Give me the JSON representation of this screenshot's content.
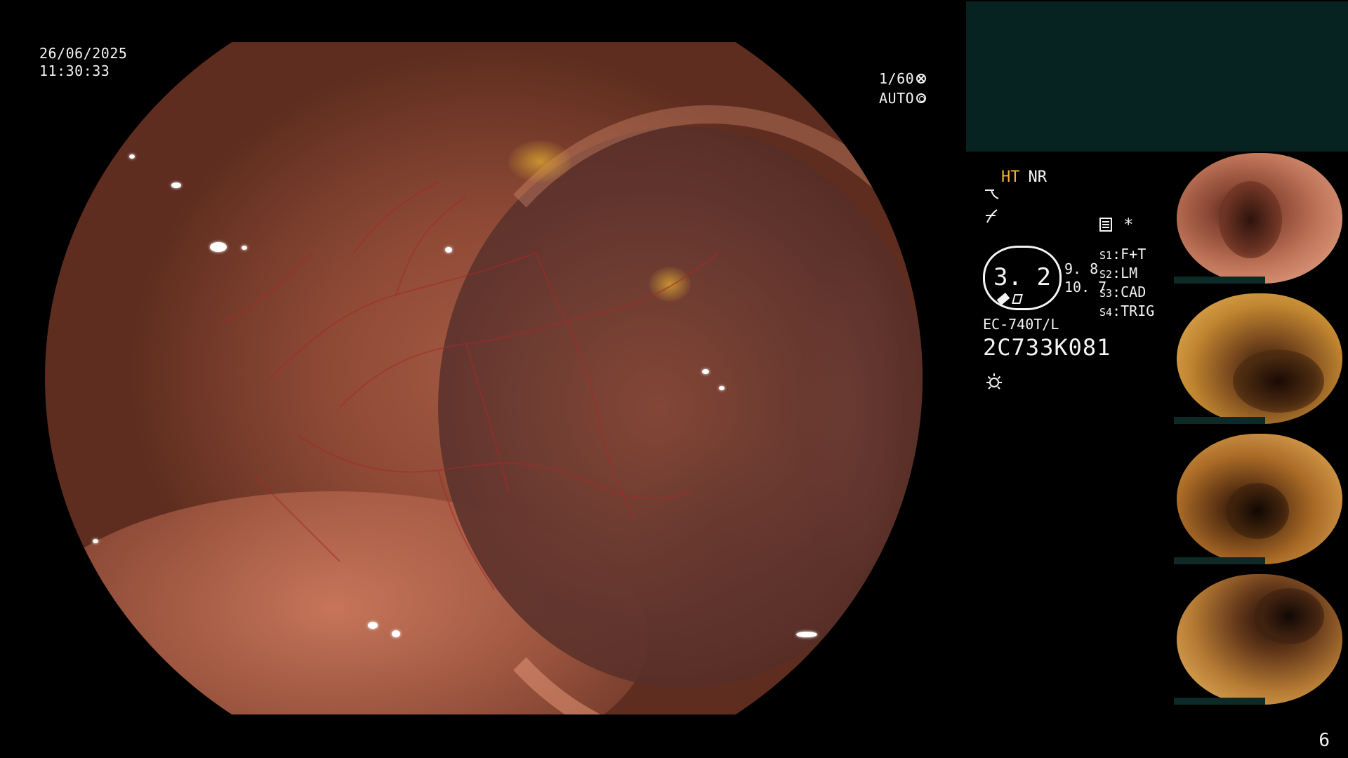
{
  "overlay": {
    "date": "26/06/2025",
    "time": "11:30:33",
    "shutter": "1/60",
    "iris": "AUTO"
  },
  "status": {
    "mode_ht": "HT",
    "mode_nr": "NR",
    "asterisk": "*",
    "gauge_value": "3. 2",
    "gauge_side_1": "9. 8",
    "gauge_side_2": "10. 7",
    "slots": [
      {
        "key": "S1",
        "value": "F+T"
      },
      {
        "key": "S2",
        "value": "LM"
      },
      {
        "key": "S3",
        "value": "CAD"
      },
      {
        "key": "S4",
        "value": "TRIG"
      }
    ],
    "scope_model": "EC-740T/L",
    "serial": "2C733K081"
  },
  "icons": {
    "aperture": "aperture-icon",
    "auto": "auto-iris-icon",
    "enhance_1": "enhancement-curve-icon",
    "enhance_2": "enhancement-slash-icon",
    "record": "record-doc-icon",
    "light": "light-sun-icon"
  },
  "thumbnails": [
    {
      "label": "thumbnail-1"
    },
    {
      "label": "thumbnail-2"
    },
    {
      "label": "thumbnail-3"
    },
    {
      "label": "thumbnail-4"
    }
  ],
  "page_number": "6",
  "colors": {
    "accent_ht": "#f1b43a",
    "panel_bg": "#072321"
  }
}
